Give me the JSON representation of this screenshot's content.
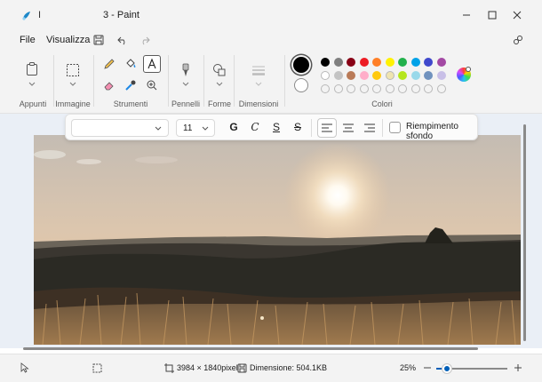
{
  "window": {
    "title_cursor": "I",
    "title": "3 - Paint"
  },
  "menu": {
    "file": "File",
    "view": "Visualizza"
  },
  "ribbon": {
    "groups": {
      "clipboard": "Appunti",
      "image": "Immagine",
      "tools": "Strumenti",
      "brushes": "Pennelli",
      "shapes": "Forme",
      "size": "Dimensioni",
      "colors": "Colori"
    },
    "active_tool": "text-tool",
    "color1": "#000000",
    "color2": "#ffffff",
    "palette_row1": [
      "#000000",
      "#7f7f7f",
      "#880015",
      "#ed1c24",
      "#ff7f27",
      "#fff200",
      "#22b14c",
      "#00a2e8",
      "#3f48cc",
      "#a349a4"
    ],
    "palette_row2": [
      "#ffffff",
      "#c3c3c3",
      "#b97a57",
      "#ffaec9",
      "#ffc90e",
      "#efe4b0",
      "#b5e61d",
      "#99d9ea",
      "#7092be",
      "#c8bfe7"
    ]
  },
  "textbar": {
    "font": "",
    "size": "11",
    "bold": "G",
    "italic": "C",
    "underline": "S",
    "strikethrough": "S",
    "fill_label": "Riempimento sfondo",
    "alignment": "left"
  },
  "status": {
    "dimensions": "3984 × 1840pixel",
    "filesize": "Dimensione: 504.1KB",
    "zoom": "25%",
    "zoom_level": 0.25
  }
}
